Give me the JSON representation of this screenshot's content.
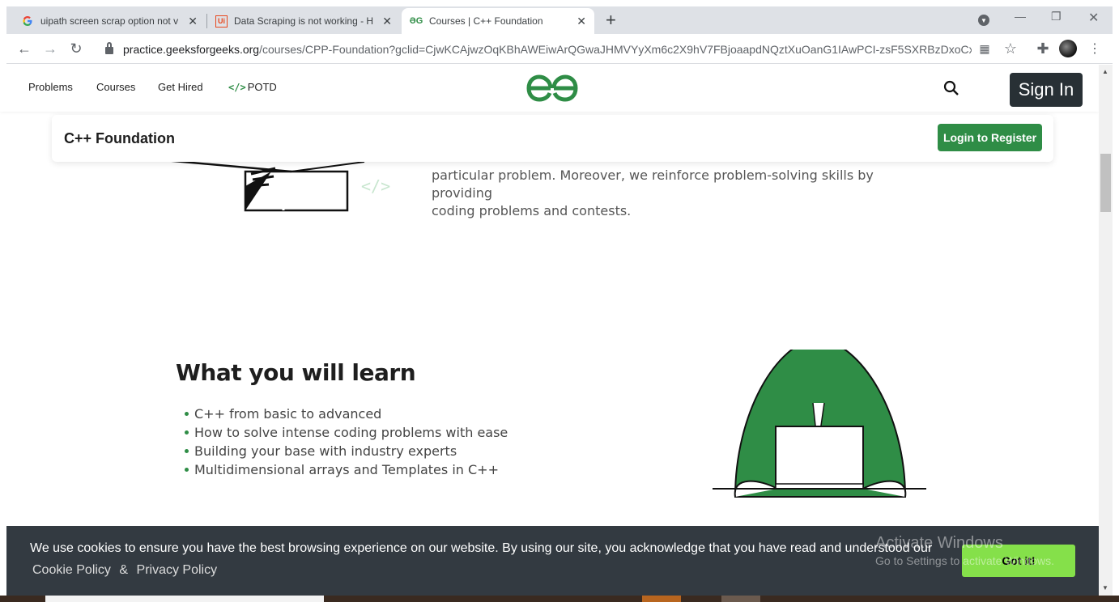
{
  "browser": {
    "tabs": [
      {
        "title": "uipath screen scrap option not v",
        "icon": "google-g-icon"
      },
      {
        "title": "Data Scraping is not working - H",
        "icon": "uipath-icon"
      },
      {
        "title": "Courses | C++ Foundation",
        "icon": "gfg-icon"
      }
    ],
    "url_host": "practice.geeksforgeeks.org",
    "url_path": "/courses/CPP-Foundation?gclid=CjwKCAjwzOqKBhAWEiwArQGwaJHMVYyXm6c2X9hV7FBjoaapdNQztXuOanG1IAwPCI-zsF5SXRBzDxoCx0oQ..."
  },
  "nav": {
    "problems": "Problems",
    "courses": "Courses",
    "get_hired": "Get Hired",
    "potd_code": "</>",
    "potd": "POTD",
    "sign_in": "Sign In"
  },
  "course": {
    "title": "C++ Foundation",
    "login_button": "Login to Register",
    "intro_line1": "particular problem. Moreover, we reinforce problem-solving skills by providing",
    "intro_line2": "coding problems and contests."
  },
  "learn": {
    "title": "What you will learn",
    "items": [
      "C++ from basic to advanced",
      "How to solve intense coding problems with ease",
      "Building your base with industry experts",
      "Multidimensional arrays and Templates in C++"
    ]
  },
  "cookie": {
    "message": "We use cookies to ensure you have the best browsing experience on our website. By using our site, you acknowledge that you have read and understood our",
    "cookie_policy": "Cookie Policy",
    "amp": "&",
    "privacy_policy": "Privacy Policy",
    "got_it": "Got it!"
  },
  "windows": {
    "activate_title": "Activate Windows",
    "activate_sub": "Go to Settings to activate Windows."
  },
  "colors": {
    "brand_green": "#2f8d46",
    "signin_dark": "#283035",
    "cookie_bg": "#333a41",
    "gotit_green": "#85e04a"
  }
}
